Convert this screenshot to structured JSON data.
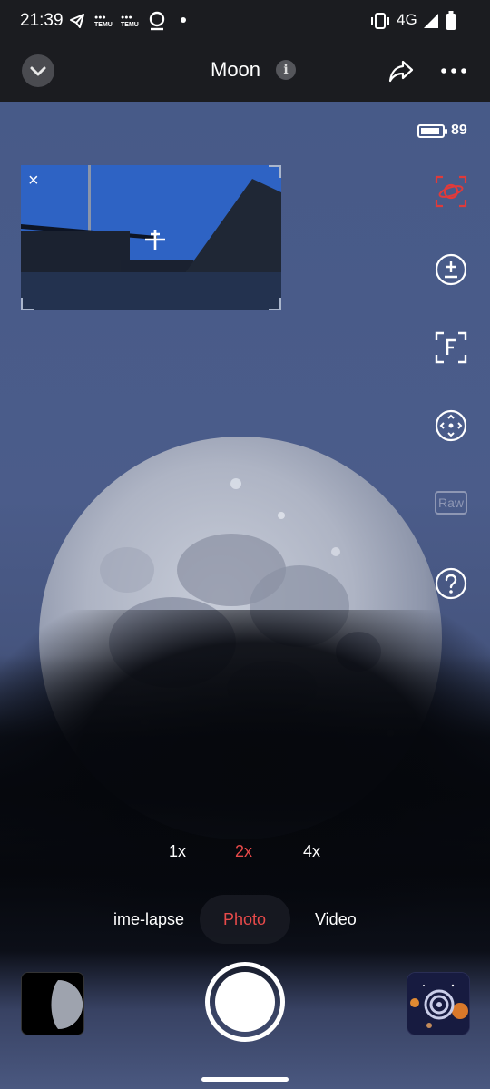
{
  "status_bar": {
    "time": "21:39",
    "temu_1": "TEMU",
    "temu_2": "TEMU",
    "network": "4G",
    "icons": [
      "telegram-icon",
      "temu-icon",
      "temu-icon",
      "location-pin-icon",
      "vibrate-icon",
      "signal-icon",
      "battery-icon"
    ]
  },
  "header": {
    "title": "Moon",
    "info": "i"
  },
  "battery": {
    "level": "89",
    "fraction": 0.89
  },
  "preview": {
    "close": "×"
  },
  "toolbar": {
    "items": [
      "moon-mode-icon",
      "exposure-compensation-icon",
      "focus-icon",
      "move-direction-icon",
      "raw-icon",
      "help-icon"
    ],
    "raw_label": "Raw",
    "accent_color": "#e03a3a"
  },
  "zoom": {
    "options": [
      "1x",
      "2x",
      "4x"
    ],
    "selected": "2x"
  },
  "modes": {
    "items": [
      "ime-lapse",
      "Photo",
      "Video"
    ],
    "selected": "Photo"
  },
  "colors": {
    "accent": "#e84a4a",
    "bar_bg": "#1b1c20",
    "sky": "#475a88"
  }
}
